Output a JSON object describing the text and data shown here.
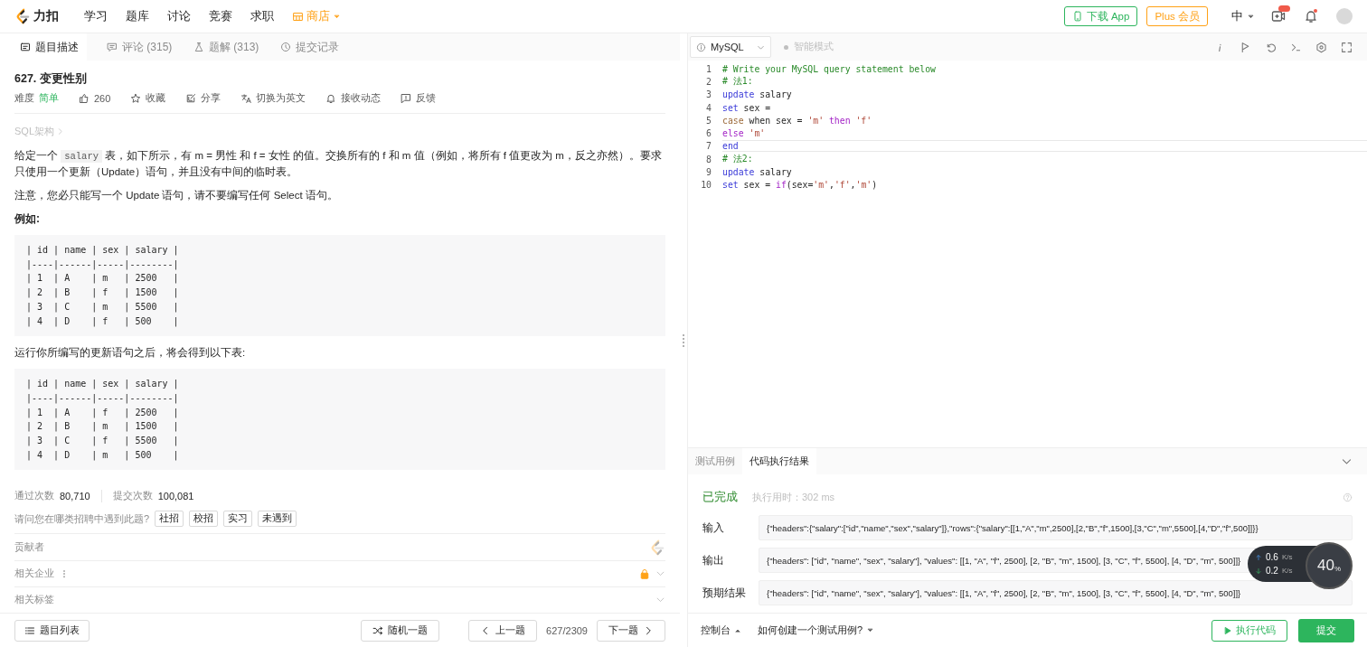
{
  "nav": {
    "brand": "力扣",
    "items": [
      {
        "label": "学习",
        "kind": "plain"
      },
      {
        "label": "题库",
        "kind": "plain"
      },
      {
        "label": "讨论",
        "kind": "plain"
      },
      {
        "label": "竞赛",
        "kind": "plain"
      },
      {
        "label": "求职",
        "kind": "plain"
      },
      {
        "label": "商店",
        "kind": "store"
      }
    ],
    "download": "下载 App",
    "plus": "Plus 会员",
    "language": "中"
  },
  "left_tabs": [
    {
      "label": "题目描述",
      "selected": true
    },
    {
      "label": "评论 (315)",
      "selected": false
    },
    {
      "label": "题解 (313)",
      "selected": false
    },
    {
      "label": "提交记录",
      "selected": false
    }
  ],
  "problem": {
    "title": "627. 变更性别",
    "difficulty_label": "难度",
    "difficulty": "简单",
    "actions": [
      "260",
      "收藏",
      "分享",
      "切换为英文",
      "接收动态",
      "反馈"
    ],
    "breadcrumb": "SQL架构",
    "description": [
      {
        "kind": "text",
        "text": "给定一个 "
      },
      {
        "kind": "code",
        "text": "salary"
      },
      {
        "kind": "text",
        "text": " 表，如下所示，有 m = 男性 和 f = 女性 的值。交换所有的 f 和 m 值（例如，将所有 f 值更改为 m，反之亦然）。要求只使用一个更新（Update）语句，并且没有中间的临时表。"
      }
    ],
    "note": "注意，您必只能写一个 Update 语句，请不要编写任何 Select 语句。",
    "example_heading": "例如:",
    "example_before": [
      "| id | name | sex | salary |",
      "|----|------|-----|--------|",
      "| 1  | A    | m   | 2500   |",
      "| 2  | B    | f   | 1500   |",
      "| 3  | C    | m   | 5500   |",
      "| 4  | D    | f   | 500    |"
    ],
    "after_text": "运行你所编写的更新语句之后，将会得到以下表:",
    "example_after": [
      "| id | name | sex | salary |",
      "|----|------|-----|--------|",
      "| 1  | A    | f   | 2500   |",
      "| 2  | B    | m   | 1500   |",
      "| 3  | C    | f   | 5500   |",
      "| 4  | D    | m   | 500    |"
    ],
    "stats": [
      {
        "label": "通过次数",
        "value": "80,710"
      },
      {
        "label": "提交次数",
        "value": "100,081"
      }
    ],
    "question": "请问您在哪类招聘中遇到此题?",
    "tags": [
      "社招",
      "校招",
      "实习",
      "未遇到"
    ],
    "sections": [
      {
        "label": "贡献者",
        "kind": "contributors"
      },
      {
        "label": "相关企业",
        "kind": "locked"
      },
      {
        "label": "相关标签",
        "kind": "collapsible"
      }
    ]
  },
  "bottom": {
    "list": "题目列表",
    "random": "随机一题",
    "prev": "上一题",
    "counter": "627/2309",
    "next": "下一题"
  },
  "editor": {
    "language": "MySQL",
    "mode": "智能模式",
    "mode_on": false,
    "lines": [
      {
        "number": "1",
        "current": false,
        "tokens": [
          {
            "kind": "comment",
            "text": "# Write your MySQL query statement below"
          }
        ]
      },
      {
        "number": "2",
        "current": false,
        "tokens": [
          {
            "kind": "comment",
            "text": "# 法1:"
          }
        ]
      },
      {
        "number": "3",
        "current": false,
        "tokens": [
          {
            "kind": "keyword",
            "text": "update"
          },
          {
            "kind": "plain",
            "text": " salary"
          }
        ]
      },
      {
        "number": "4",
        "current": false,
        "tokens": [
          {
            "kind": "keyword",
            "text": "set"
          },
          {
            "kind": "plain",
            "text": " sex ="
          }
        ]
      },
      {
        "number": "5",
        "current": false,
        "tokens": [
          {
            "kind": "builtin",
            "text": "case"
          },
          {
            "kind": "plain",
            "text": " when sex = "
          },
          {
            "kind": "string",
            "text": "'m'"
          },
          {
            "kind": "control",
            "text": " then "
          },
          {
            "kind": "string",
            "text": "'f'"
          }
        ]
      },
      {
        "number": "6",
        "current": false,
        "tokens": [
          {
            "kind": "control",
            "text": "else "
          },
          {
            "kind": "string",
            "text": "'m'"
          }
        ]
      },
      {
        "number": "7",
        "current": true,
        "tokens": [
          {
            "kind": "keyword",
            "text": "end"
          }
        ]
      },
      {
        "number": "8",
        "current": false,
        "tokens": [
          {
            "kind": "comment",
            "text": "# 法2:"
          }
        ]
      },
      {
        "number": "9",
        "current": false,
        "tokens": [
          {
            "kind": "keyword",
            "text": "update"
          },
          {
            "kind": "plain",
            "text": " salary"
          }
        ]
      },
      {
        "number": "10",
        "current": false,
        "tokens": [
          {
            "kind": "keyword",
            "text": "set"
          },
          {
            "kind": "plain",
            "text": " sex = "
          },
          {
            "kind": "control",
            "text": "if"
          },
          {
            "kind": "plain",
            "text": "(sex="
          },
          {
            "kind": "string",
            "text": "'m'"
          },
          {
            "kind": "plain",
            "text": ","
          },
          {
            "kind": "string",
            "text": "'f'"
          },
          {
            "kind": "plain",
            "text": ","
          },
          {
            "kind": "string",
            "text": "'m'"
          },
          {
            "kind": "plain",
            "text": ")"
          }
        ]
      }
    ]
  },
  "result": {
    "tabs": [
      {
        "label": "测试用例",
        "selected": false
      },
      {
        "label": "代码执行结果",
        "selected": true
      }
    ],
    "status": "已完成",
    "runtime": "执行用时：302 ms",
    "rows": [
      {
        "label": "输入",
        "value": "{\"headers\":{\"salary\":[\"id\",\"name\",\"sex\",\"salary\"]},\"rows\":{\"salary\":[[1,\"A\",\"m\",2500],[2,\"B\",\"f\",1500],[3,\"C\",\"m\",5500],[4,\"D\",\"f\",500]]}}"
      },
      {
        "label": "输出",
        "value": "{\"headers\": [\"id\", \"name\", \"sex\", \"salary\"], \"values\": [[1, \"A\", \"f\", 2500], [2, \"B\", \"m\", 1500], [3, \"C\", \"f\", 5500], [4, \"D\", \"m\", 500]]}"
      },
      {
        "label": "预期结果",
        "value": "{\"headers\": [\"id\", \"name\", \"sex\", \"salary\"], \"values\": [[1, \"A\", \"f\", 2500], [2, \"B\", \"m\", 1500], [3, \"C\", \"f\", 5500], [4, \"D\", \"m\", 500]]}"
      }
    ],
    "console": "控制台",
    "howto": "如何创建一个测试用例?",
    "run": "执行代码",
    "submit": "提交"
  },
  "speed_widget": {
    "up": "0.6",
    "up_unit": "K/s",
    "down": "0.2",
    "down_unit": "K/s",
    "percent": "40",
    "percent_unit": "%"
  }
}
